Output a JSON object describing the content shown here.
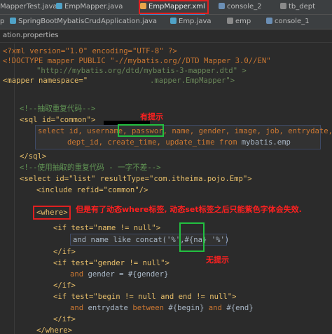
{
  "tabs_top": [
    {
      "label": "MapperTest.java",
      "icon": "java-class-icon",
      "active": false
    },
    {
      "label": "EmpMapper.java",
      "icon": "interface-icon",
      "active": false
    },
    {
      "label": "EmpMapper.xml",
      "icon": "xml-file-icon",
      "active": true
    },
    {
      "label": "console_2",
      "icon": "console-icon",
      "active": false
    },
    {
      "label": "tb_dept",
      "icon": "table-icon",
      "active": false
    }
  ],
  "tabs_second": [
    {
      "label": "p",
      "icon": "java-class-icon"
    },
    {
      "label": "SpringBootMybatisCrudApplication.java",
      "icon": "java-class-icon"
    },
    {
      "label": "Emp.java",
      "icon": "java-class-icon"
    },
    {
      "label": "emp",
      "icon": "table-icon"
    },
    {
      "label": "console_1",
      "icon": "console-icon"
    }
  ],
  "file_label": "ation.properties",
  "code": {
    "l1": "<?xml version=\"1.0\" encoding=\"UTF-8\" ?>",
    "l2a": "<!DOCTYPE mapper PUBLIC \"-//mybatis.org//DTD Mapper 3.0//EN\"",
    "l2b": "\"http://mybatis.org/dtd/mybatis-3-mapper.dtd\" >",
    "l3_open": "<mapper namespace=\"",
    "l3_suffix": ".mapper.EmpMapper\">",
    "c1": "<!--抽取重复代码-->",
    "sql_open": "<sql id=\"common\">",
    "sel1a": "select id, username,",
    "sel1b": "passwor",
    "sel1c": "name, gender, image, job, entrydate,",
    "sel2a": "dept_id, create_time, update_time",
    "sel2_from": "from",
    "sel2c": "mybatis.emp",
    "sql_close": "</sql>",
    "c2": "<!--使用抽取的重复代码 - 一字不差-->",
    "select_open": "<select id=\"list\" resultType=\"com.itheima.pojo.Emp\">",
    "include": "<include refid=\"common\"/>",
    "where_open": "<where>",
    "if1": "<if test=\"name != null\">",
    "cond1a": "and",
    "cond1b": "name",
    "cond1c": "like",
    "cond1d": "concat('%',#{na}",
    "cond1e": "'%')",
    "if_close": "</if>",
    "if2": "<if test=\"gender != null\">",
    "cond2a": "and",
    "cond2b": "gender = #{gender}",
    "if3": "<if test=\"begin != null and end != null\">",
    "cond3a": "and",
    "cond3b": "entrydate",
    "cond3c": "between",
    "cond3d": "#{begin}",
    "cond3e": "and",
    "cond3f": "#{end}",
    "where_close": "</where>"
  },
  "annotations": {
    "hint_yes": "有提示",
    "hint_note": "但是有了动态where标签, 动态set标签之后只能紫色字体会失效.",
    "hint_no": "无提示"
  },
  "colors": {
    "annotation_red": "#ff2020",
    "highlight_green": "#22c040",
    "tag_yellow": "#e8bf6a",
    "comment_green": "#629755",
    "keyword_orange": "#cc7832"
  }
}
